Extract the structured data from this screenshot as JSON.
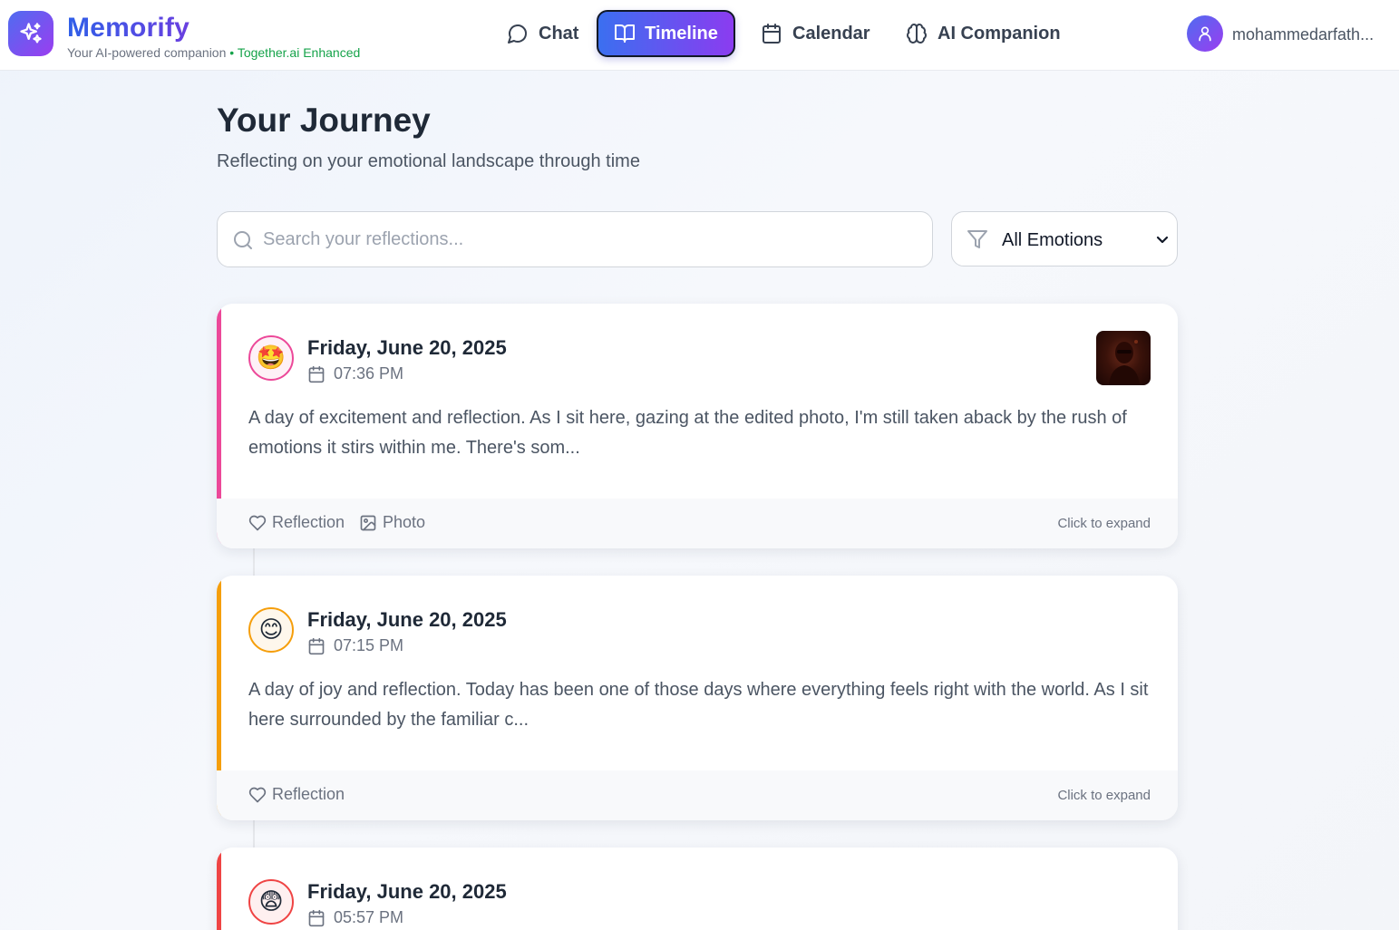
{
  "brand": {
    "name": "Memorify",
    "tagline": "Your AI-powered companion",
    "separator": " • ",
    "enhanced": "Together.ai Enhanced",
    "logo_icon": "sparkles-icon"
  },
  "nav": {
    "chat": "Chat",
    "timeline": "Timeline",
    "calendar": "Calendar",
    "ai": "AI Companion",
    "active": "Timeline"
  },
  "user": {
    "name": "mohammedarfath..."
  },
  "page": {
    "title": "Your Journey",
    "subtitle": "Reflecting on your emotional landscape through time"
  },
  "search": {
    "placeholder": "Search your reflections...",
    "value": ""
  },
  "filter": {
    "selected": "All Emotions"
  },
  "entries": [
    {
      "emoji": "🤩",
      "accent": "#ec4899",
      "date": "Friday, June 20, 2025",
      "time": "07:36 PM",
      "text": "A day of excitement and reflection. As I sit here, gazing at the edited photo, I'm still taken aback by the rush of emotions it stirs within me. There's som...",
      "tags": [
        "Reflection",
        "Photo"
      ],
      "expand": "Click to expand"
    },
    {
      "emoji": "😊",
      "accent": "#f59e0b",
      "date": "Friday, June 20, 2025",
      "time": "07:15 PM",
      "text": "A day of joy and reflection. Today has been one of those days where everything feels right with the world. As I sit here surrounded by the familiar c...",
      "tags": [
        "Reflection"
      ],
      "expand": "Click to expand"
    },
    {
      "emoji": "😨",
      "accent": "#ef4444",
      "date": "Friday, June 20, 2025",
      "time": "05:57 PM"
    }
  ]
}
